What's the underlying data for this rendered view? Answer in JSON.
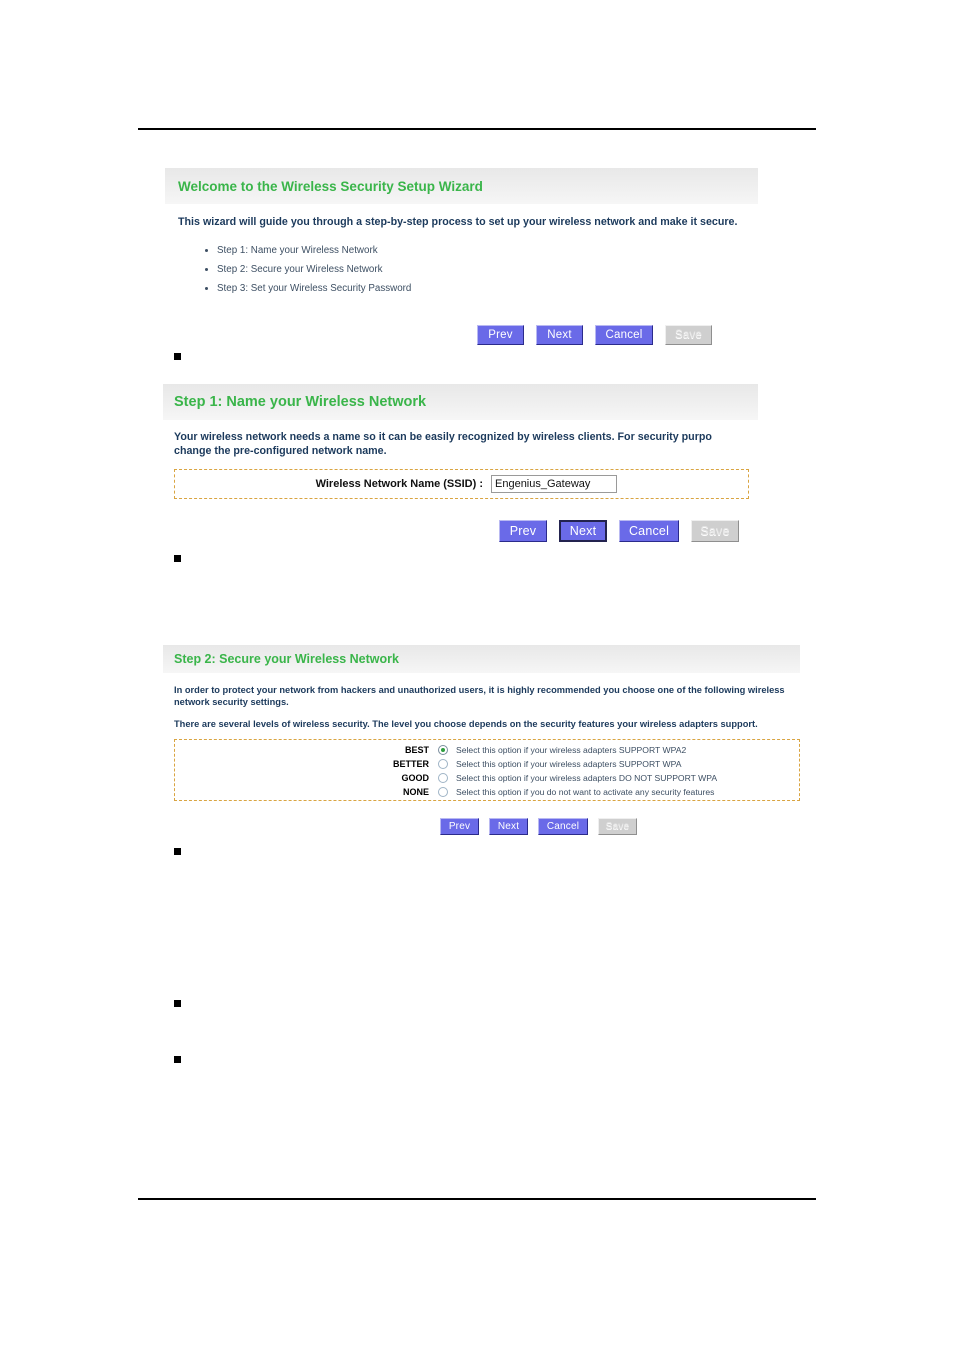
{
  "page": {
    "rules": [
      "top-rule",
      "bottom-rule"
    ]
  },
  "panel_welcome": {
    "title": "Welcome to the Wireless Security Setup Wizard",
    "intro": "This wizard will guide you through a step-by-step process to set up your wireless network and make it secure.",
    "steps": [
      "Step 1: Name your Wireless Network",
      "Step 2: Secure your Wireless Network",
      "Step 3: Set your Wireless Security Password"
    ],
    "buttons": [
      {
        "label": "Prev",
        "state": "enabled"
      },
      {
        "label": "Next",
        "state": "enabled"
      },
      {
        "label": "Cancel",
        "state": "enabled"
      },
      {
        "label": "Save",
        "state": "disabled"
      }
    ]
  },
  "panel_step1": {
    "title": "Step 1: Name your Wireless Network",
    "description_line1": "Your wireless network needs a name so it can be easily recognized by wireless clients. For security purpo",
    "description_line2": "change the pre-configured network name.",
    "field": {
      "label": "Wireless Network Name (SSID) :",
      "value": "Engenius_Gateway"
    },
    "buttons": [
      {
        "label": "Prev",
        "state": "enabled"
      },
      {
        "label": "Next",
        "state": "focused"
      },
      {
        "label": "Cancel",
        "state": "enabled"
      },
      {
        "label": "Save",
        "state": "disabled"
      }
    ]
  },
  "panel_step2": {
    "title": "Step 2: Secure your Wireless Network",
    "description_line1": "In order to protect your network from hackers and unauthorized users, it is highly recommended you choose one of the following wireless",
    "description_line2": "network security settings.",
    "description_line3": "There are several levels of wireless security. The level you choose depends on the security features your wireless adapters support.",
    "options": [
      {
        "tier": "BEST",
        "description": "Select this option if your wireless adapters SUPPORT WPA2",
        "selected": true
      },
      {
        "tier": "BETTER",
        "description": "Select this option if your wireless adapters SUPPORT WPA",
        "selected": false
      },
      {
        "tier": "GOOD",
        "description": "Select this option if your wireless adapters DO NOT SUPPORT WPA",
        "selected": false
      },
      {
        "tier": "NONE",
        "description": "Select this option if you do not want to activate any security features",
        "selected": false
      }
    ],
    "buttons": [
      {
        "label": "Prev",
        "state": "enabled"
      },
      {
        "label": "Next",
        "state": "enabled"
      },
      {
        "label": "Cancel",
        "state": "enabled"
      },
      {
        "label": "Save",
        "state": "disabled"
      }
    ]
  },
  "colors": {
    "header_text_green": "#3ab54a",
    "body_text_navy": "#1c3a5c",
    "button_blue": "#6a6ae8",
    "button_disabled": "#cfcfcf",
    "dashed_border": "#d9a441",
    "radio_selected": "#2f9e3f"
  }
}
